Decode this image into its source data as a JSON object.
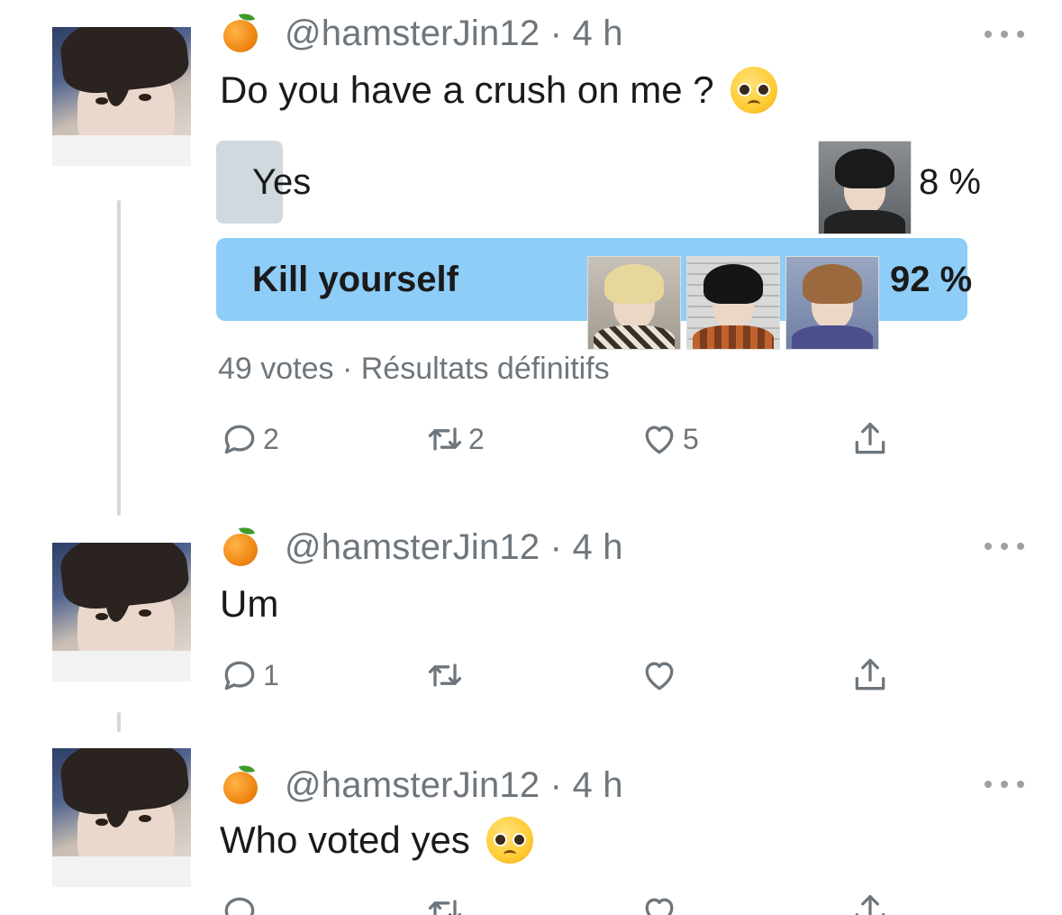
{
  "colors": {
    "poll_winner_fill": "#8ecdf8",
    "poll_loser_fill": "#cfd9de",
    "muted_text": "#6e767d",
    "thread_line": "#d4d6d8"
  },
  "tweets": [
    {
      "handle": "@hamsterJin12",
      "time": "4 h",
      "text": "Do you have a crush on me ?",
      "emoji": "pleading-face",
      "poll": {
        "options": [
          {
            "label": "Yes",
            "percent_text": "8 %",
            "percent": 8,
            "winner": false
          },
          {
            "label": "Kill yourself",
            "percent_text": "92 %",
            "percent": 92,
            "winner": true
          }
        ],
        "meta": "49 votes · Résultats définitifs"
      },
      "actions": {
        "replies": "2",
        "retweets": "2",
        "likes": "5"
      }
    },
    {
      "handle": "@hamsterJin12",
      "time": "4 h",
      "text": "Um",
      "actions": {
        "replies": "1",
        "retweets": "",
        "likes": ""
      }
    },
    {
      "handle": "@hamsterJin12",
      "time": "4 h",
      "text": "Who voted yes",
      "emoji": "pleading-face"
    }
  ]
}
